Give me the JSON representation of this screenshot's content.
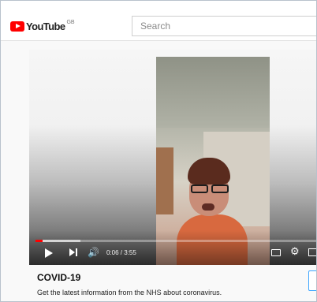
{
  "header": {
    "logo_text": "YouTube",
    "region": "GB",
    "search_placeholder": "Search"
  },
  "player": {
    "time": "0:06 / 3:55",
    "played_fraction": 0.026,
    "buffered_fraction": 0.16,
    "icons": [
      "play-icon",
      "next-icon",
      "volume-icon",
      "subtitles-icon",
      "gear-icon",
      "miniplayer-icon"
    ]
  },
  "info_panel": {
    "title": "COVID-19",
    "text": "Get the latest information from the NHS about coronavirus."
  },
  "colors": {
    "brand": "#ff0000",
    "progress_played": "#ff0000",
    "panel_button_border": "#3ea6ff"
  }
}
